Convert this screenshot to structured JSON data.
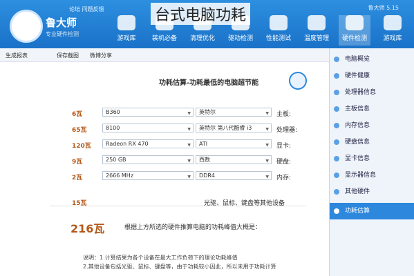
{
  "overlay_title": "台式电脑功耗",
  "header": {
    "app_name": "鲁大师",
    "app_sub": "专业硬件检测",
    "mini_tabs": "论坛  问题反馈",
    "window_ctrl": "鲁大师 5.15",
    "buttons": [
      "游戏库",
      "硬件检测",
      "温度管理",
      "性能测试",
      "驱动检测",
      "清理优化",
      "装机必备",
      "游戏库"
    ]
  },
  "toolbar": {
    "share": "微博分享",
    "save": "保存截图",
    "report": "生成报表"
  },
  "sidebar": {
    "items": [
      "电脑概览",
      "硬件健康",
      "处理器信息",
      "主板信息",
      "内存信息",
      "硬盘信息",
      "显卡信息",
      "显示器信息",
      "其他硬件",
      "功耗估算"
    ],
    "active_index": 9
  },
  "panel": {
    "title": "功耗估算-功耗最低的电脑超节能"
  },
  "rows": [
    {
      "label": "主板:",
      "brand": "英特尔",
      "model": "B360",
      "price": "6瓦"
    },
    {
      "label": "处理器:",
      "brand": "英特尔 第八代酷睿 i3",
      "model": "8100",
      "price": "65瓦"
    },
    {
      "label": "显卡:",
      "brand": "ATI",
      "model": "Radeon RX 470",
      "price": "120瓦"
    },
    {
      "label": "硬盘:",
      "brand": "西数",
      "model": "250 GB",
      "price": "9瓦"
    },
    {
      "label": "内存:",
      "brand": "DDR4",
      "model": "2666 MHz",
      "price": "2瓦"
    }
  ],
  "other": {
    "label": "光驱、鼠标、键盘等其他设备",
    "price": "15瓦"
  },
  "total": {
    "label": "根据上方所选的硬件推算电脑的功耗峰值大概是：",
    "value": "216瓦"
  },
  "notes": [
    "说明：1.计算结果为各个设备在最大工作负荷下的理论功耗峰值",
    "2.其他设备包括光驱、鼠标、键盘等，由于功耗较小因此，所以未用于功耗计算"
  ]
}
